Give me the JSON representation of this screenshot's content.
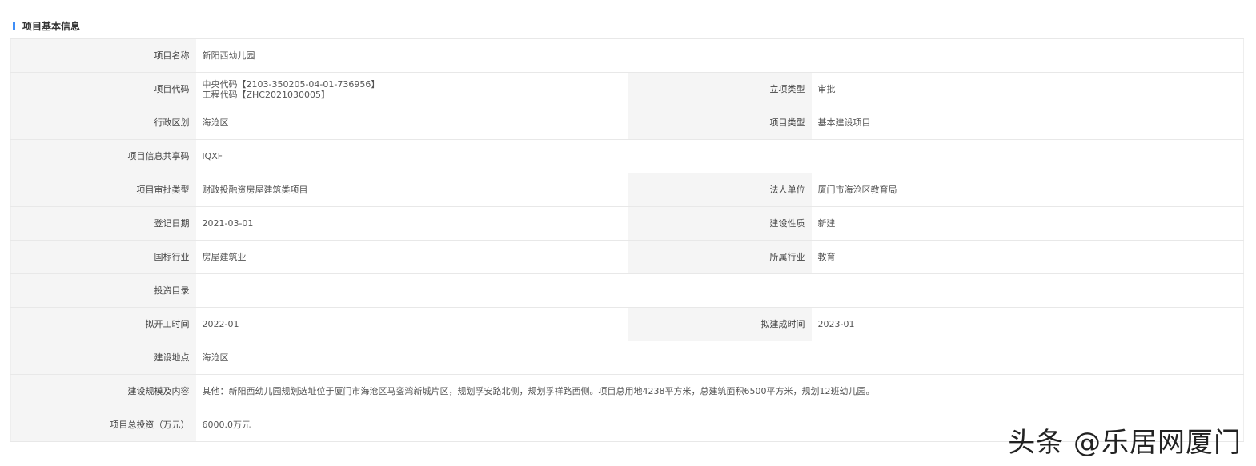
{
  "section_title": "项目基本信息",
  "rows": [
    {
      "label": "项目名称",
      "value": "新阳西幼儿园"
    },
    {
      "label": "项目代码",
      "value": "中央代码【2103-350205-04-01-736956】",
      "value2": "工程代码【ZHC2021030005】",
      "label_b": "立项类型",
      "value_b": "审批"
    },
    {
      "label": "行政区划",
      "value": "海沧区",
      "label_b": "项目类型",
      "value_b": "基本建设项目"
    },
    {
      "label": "项目信息共享码",
      "value": "lQXF"
    },
    {
      "label": "项目审批类型",
      "value": "财政投融资房屋建筑类项目",
      "label_b": "法人单位",
      "value_b": "厦门市海沧区教育局"
    },
    {
      "label": "登记日期",
      "value": "2021-03-01",
      "label_b": "建设性质",
      "value_b": "新建"
    },
    {
      "label": "国标行业",
      "value": "房屋建筑业",
      "label_b": "所属行业",
      "value_b": "教育"
    },
    {
      "label": "投资目录",
      "value": ""
    },
    {
      "label": "拟开工时间",
      "value": "2022-01",
      "label_b": "拟建成时间",
      "value_b": "2023-01"
    },
    {
      "label": "建设地点",
      "value": "海沧区"
    },
    {
      "label": "建设规模及内容",
      "value": "其他：新阳西幼儿园规划选址位于厦门市海沧区马銮湾新城片区，规划孚安路北侧，规划孚祥路西侧。项目总用地4238平方米，总建筑面积6500平方米，规划12班幼儿园。"
    },
    {
      "label": "项目总投资（万元）",
      "value": "6000.0万元"
    }
  ],
  "watermark": "头条 @乐居网厦门"
}
